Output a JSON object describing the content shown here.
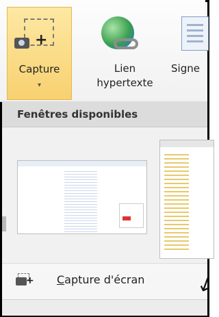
{
  "ribbon": {
    "capture": {
      "label": "Capture",
      "arrow": "▾"
    },
    "hyperlink": {
      "label_line1": "Lien",
      "label_line2": "hypertexte"
    },
    "signature": {
      "label": "Signe"
    }
  },
  "gallery": {
    "header": "Fenêtres disponibles"
  },
  "command": {
    "label_rest": "apture d'écran",
    "label_first": "C"
  },
  "annotation": {
    "arrow": "↙"
  }
}
